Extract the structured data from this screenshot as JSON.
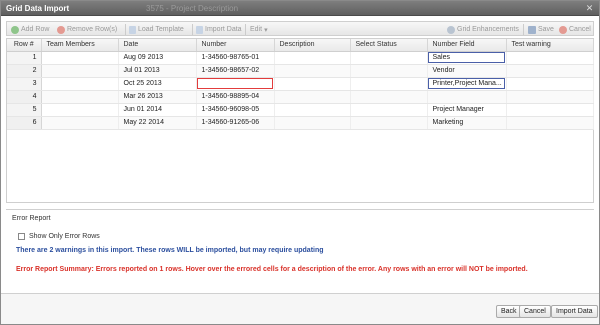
{
  "window": {
    "title": "Grid Data Import",
    "background_title": "3575 - Project Description"
  },
  "toolbar": {
    "add_row": "Add Row",
    "remove_rows": "Remove Row(s)",
    "load_template": "Load Template",
    "import_data": "Import Data",
    "edit": "Edit",
    "grid_enhancements": "Grid Enhancements",
    "save": "Save",
    "cancel": "Cancel"
  },
  "grid": {
    "columns": [
      "Row #",
      "Team Members",
      "Date",
      "Number",
      "Description",
      "Select Status",
      "Number Field",
      "Test warning"
    ],
    "rows": [
      {
        "row": "1",
        "team": "",
        "date": "Aug 09 2013",
        "number": "1-34560-98765-01",
        "description": "",
        "status": "",
        "field": "Sales",
        "warning": ""
      },
      {
        "row": "2",
        "team": "",
        "date": "Jul 01 2013",
        "number": "1-34560-98657-02",
        "description": "",
        "status": "",
        "field": "Vendor",
        "warning": ""
      },
      {
        "row": "3",
        "team": "",
        "date": "Oct 25 2013",
        "number": "",
        "description": "",
        "status": "",
        "field": "Printer,Project Mana...",
        "warning": ""
      },
      {
        "row": "4",
        "team": "",
        "date": "Mar 26 2013",
        "number": "1-34560-98895-04",
        "description": "",
        "status": "",
        "field": "",
        "warning": ""
      },
      {
        "row": "5",
        "team": "",
        "date": "Jun 01 2014",
        "number": "1-34560-96098-05",
        "description": "",
        "status": "",
        "field": "Project Manager",
        "warning": ""
      },
      {
        "row": "6",
        "team": "",
        "date": "May 22 2014",
        "number": "1-34560-91265-06",
        "description": "",
        "status": "",
        "field": "Marketing",
        "warning": ""
      }
    ]
  },
  "error_report": {
    "title": "Error Report",
    "show_only_errors": "Show Only Error Rows",
    "warning_text": "There are 2 warnings in this import. These rows WILL be imported, but may require updating",
    "summary_text": "Error Report Summary: Errors reported on 1 rows. Hover over the errored cells for a description of the error. Any rows with an error will NOT be imported."
  },
  "footer": {
    "back": "Back",
    "cancel": "Cancel",
    "import_data": "Import Data"
  },
  "colors": {
    "warning": "#2c4f9e",
    "error": "#d9322a"
  }
}
